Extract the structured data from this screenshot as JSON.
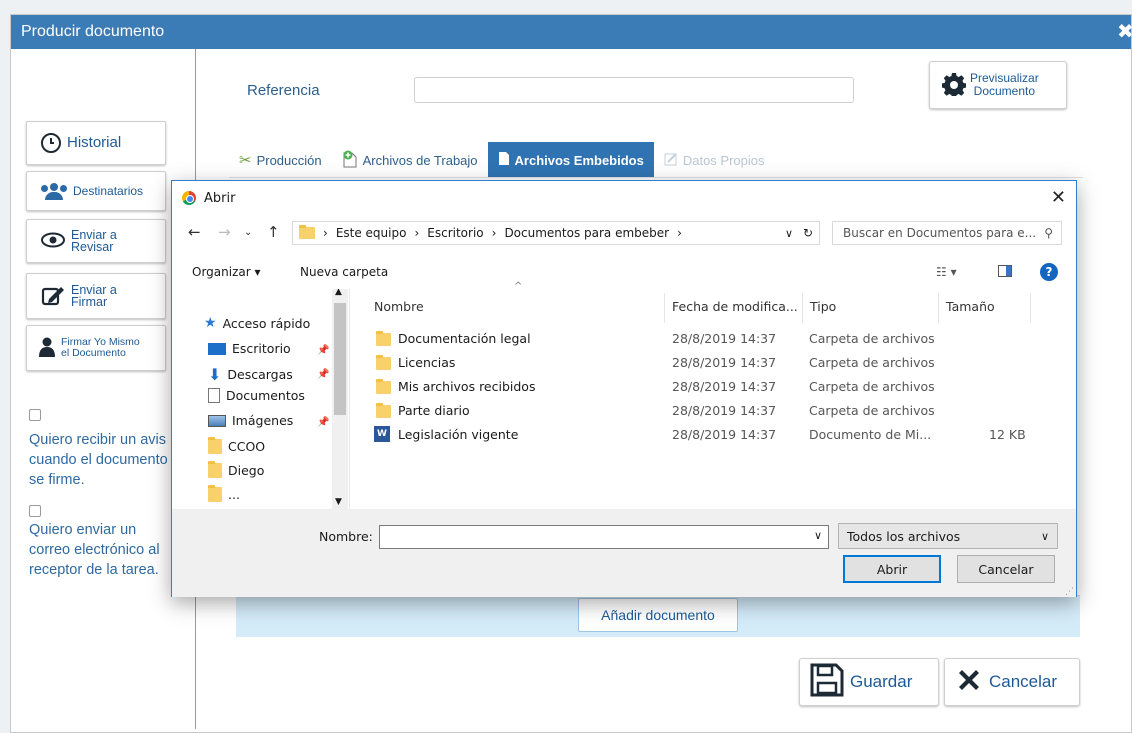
{
  "modal": {
    "title": "Producir documento",
    "close": "✖"
  },
  "side": {
    "historial": "Historial",
    "destinatarios": "Destinatarios",
    "enviar_revisar": [
      "Enviar a",
      "Revisar"
    ],
    "enviar_firmar": [
      "Enviar a",
      "Firmar"
    ],
    "firmar_mismo": [
      "Firmar Yo Mismo",
      "el Documento"
    ],
    "aviso_text": [
      "Quiero recibir un avis",
      "cuando el documento",
      "se firme."
    ],
    "correo_text": [
      "Quiero enviar un",
      "correo electrónico al",
      "receptor de la tarea."
    ]
  },
  "form": {
    "referencia_label": "Referencia",
    "preview_btn": [
      "Previsualizar",
      "Documento"
    ]
  },
  "tabs": [
    {
      "label": "Producción",
      "state": "normal"
    },
    {
      "label": "Archivos de Trabajo",
      "state": "normal"
    },
    {
      "label": "Archivos Embebidos",
      "state": "active"
    },
    {
      "label": "Datos Propios",
      "state": "disabled"
    }
  ],
  "content": {
    "add_doc": "Añadir documento",
    "guardar": "Guardar",
    "cancelar": "Cancelar"
  },
  "dialog": {
    "title": "Abrir",
    "close": "✕",
    "breadcrumb": [
      "Este equipo",
      "Escritorio",
      "Documentos para embeber"
    ],
    "search_placeholder": "Buscar en Documentos para e...",
    "organizar": "Organizar ▾",
    "nueva_carpeta": "Nueva carpeta",
    "nav": {
      "quick": "Acceso rápido",
      "items": [
        "Escritorio",
        "Descargas",
        "Documentos",
        "Imágenes",
        "CCOO",
        "Diego",
        "..."
      ]
    },
    "columns": [
      "Nombre",
      "Fecha de modifica...",
      "Tipo",
      "Tamaño"
    ],
    "files": [
      {
        "name": "Documentación legal",
        "date": "28/8/2019 14:37",
        "type": "Carpeta de archivos",
        "size": "",
        "kind": "folder"
      },
      {
        "name": "Licencias",
        "date": "28/8/2019 14:37",
        "type": "Carpeta de archivos",
        "size": "",
        "kind": "folder"
      },
      {
        "name": "Mis archivos recibidos",
        "date": "28/8/2019 14:37",
        "type": "Carpeta de archivos",
        "size": "",
        "kind": "folder"
      },
      {
        "name": "Parte diario",
        "date": "28/8/2019 14:37",
        "type": "Carpeta de archivos",
        "size": "",
        "kind": "folder"
      },
      {
        "name": "Legislación vigente",
        "date": "28/8/2019 14:37",
        "type": "Documento de Mi...",
        "size": "12 KB",
        "kind": "word"
      }
    ],
    "nombre_label": "Nombre:",
    "nombre_value": "",
    "filter": "Todos los archivos",
    "abrir": "Abrir",
    "cancelar": "Cancelar"
  }
}
